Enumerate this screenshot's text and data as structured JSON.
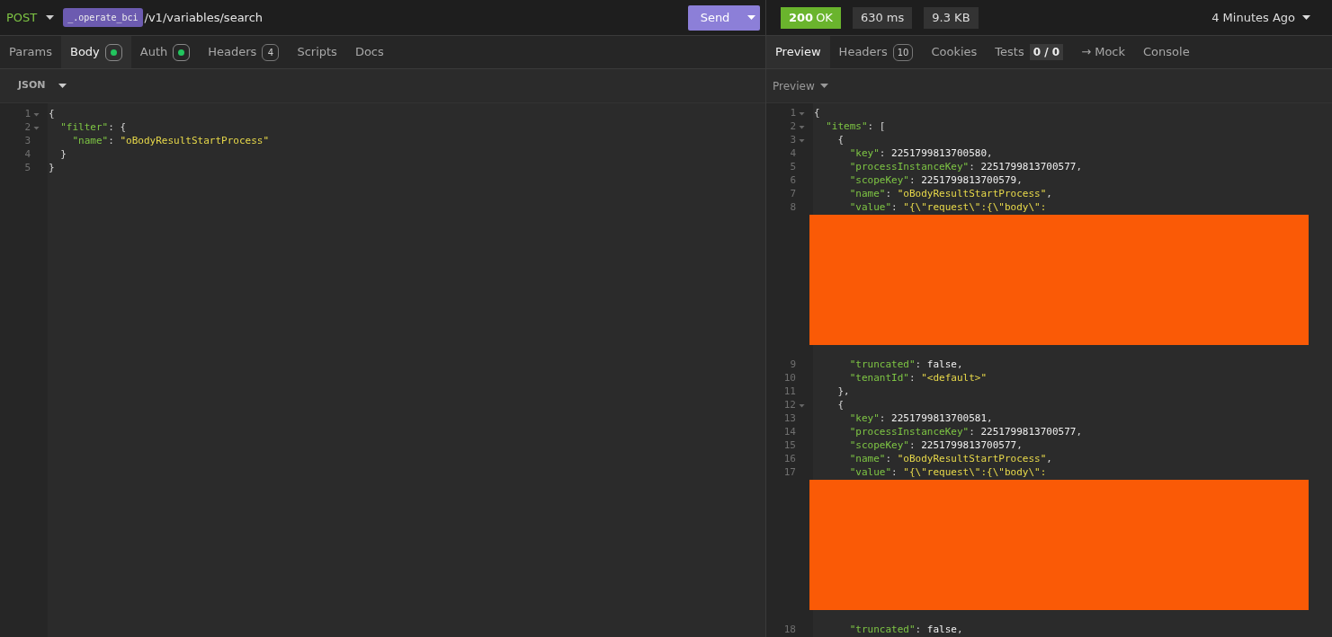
{
  "request": {
    "method": "POST",
    "env_tag": "_.operate_bci",
    "path": "/v1/variables/search",
    "send": "Send"
  },
  "request_tabs": [
    {
      "label": "Params",
      "selected": false
    },
    {
      "label": "Body",
      "selected": true,
      "badge": {
        "kind": "dot"
      }
    },
    {
      "label": "Auth",
      "selected": false,
      "badge": {
        "kind": "dot"
      }
    },
    {
      "label": "Headers",
      "selected": false,
      "badge": {
        "kind": "count",
        "text": "4"
      }
    },
    {
      "label": "Scripts",
      "selected": false
    },
    {
      "label": "Docs",
      "selected": false
    }
  ],
  "body_type": "JSON",
  "request_body": [
    {
      "number": "1",
      "fold": true,
      "tokens": [
        {
          "kind": "punct",
          "text": "{"
        }
      ]
    },
    {
      "number": "2",
      "fold": true,
      "tokens": [
        {
          "kind": "key",
          "text": "  \"filter\""
        },
        {
          "kind": "punct",
          "text": ": {"
        }
      ]
    },
    {
      "number": "3",
      "fold": false,
      "tokens": [
        {
          "kind": "key",
          "text": "    \"name\""
        },
        {
          "kind": "punct",
          "text": ": "
        },
        {
          "kind": "string",
          "text": "\"oBodyResultStartProcess\""
        }
      ]
    },
    {
      "number": "4",
      "fold": false,
      "tokens": [
        {
          "kind": "punct",
          "text": "  }"
        }
      ]
    },
    {
      "number": "5",
      "fold": false,
      "tokens": [
        {
          "kind": "punct",
          "text": "}"
        }
      ]
    }
  ],
  "response": {
    "status": "200",
    "status_text": "OK",
    "time": "630 ms",
    "size": "9.3 KB",
    "when": "4 Minutes Ago"
  },
  "response_tabs": [
    {
      "label": "Preview",
      "selected": true
    },
    {
      "label": "Headers",
      "selected": false,
      "badge": {
        "kind": "count",
        "text": "10"
      }
    },
    {
      "label": "Cookies",
      "selected": false
    },
    {
      "label": "Tests",
      "selected": false,
      "badge": {
        "kind": "score",
        "text": "0 / 0"
      }
    },
    {
      "label": "→ Mock",
      "selected": false
    },
    {
      "label": "Console",
      "selected": false
    }
  ],
  "preview_mode": "Preview",
  "response_body": [
    {
      "kind": "code",
      "number": "1",
      "fold": true,
      "tokens": [
        {
          "kind": "punct",
          "text": "{"
        }
      ]
    },
    {
      "kind": "code",
      "number": "2",
      "fold": true,
      "tokens": [
        {
          "kind": "key",
          "text": "  \"items\""
        },
        {
          "kind": "punct",
          "text": ": ["
        }
      ]
    },
    {
      "kind": "code",
      "number": "3",
      "fold": true,
      "tokens": [
        {
          "kind": "punct",
          "text": "    {"
        }
      ]
    },
    {
      "kind": "code",
      "number": "4",
      "fold": false,
      "tokens": [
        {
          "kind": "key",
          "text": "      \"key\""
        },
        {
          "kind": "punct",
          "text": ": "
        },
        {
          "kind": "number",
          "text": "2251799813700580"
        },
        {
          "kind": "punct",
          "text": ","
        }
      ]
    },
    {
      "kind": "code",
      "number": "5",
      "fold": false,
      "tokens": [
        {
          "kind": "key",
          "text": "      \"processInstanceKey\""
        },
        {
          "kind": "punct",
          "text": ": "
        },
        {
          "kind": "number",
          "text": "2251799813700577"
        },
        {
          "kind": "punct",
          "text": ","
        }
      ]
    },
    {
      "kind": "code",
      "number": "6",
      "fold": false,
      "tokens": [
        {
          "kind": "key",
          "text": "      \"scopeKey\""
        },
        {
          "kind": "punct",
          "text": ": "
        },
        {
          "kind": "number",
          "text": "2251799813700579"
        },
        {
          "kind": "punct",
          "text": ","
        }
      ]
    },
    {
      "kind": "code",
      "number": "7",
      "fold": false,
      "tokens": [
        {
          "kind": "key",
          "text": "      \"name\""
        },
        {
          "kind": "punct",
          "text": ": "
        },
        {
          "kind": "string",
          "text": "\"oBodyResultStartProcess\""
        },
        {
          "kind": "punct",
          "text": ","
        }
      ]
    },
    {
      "kind": "code",
      "number": "8",
      "fold": false,
      "tokens": [
        {
          "kind": "key",
          "text": "      \"value\""
        },
        {
          "kind": "punct",
          "text": ": "
        },
        {
          "kind": "string",
          "text": "\"{\\\"request\\\":{\\\"body\\\":"
        }
      ]
    },
    {
      "kind": "redacted"
    },
    {
      "kind": "code",
      "number": "9",
      "fold": false,
      "tokens": [
        {
          "kind": "key",
          "text": "      \"truncated\""
        },
        {
          "kind": "punct",
          "text": ": "
        },
        {
          "kind": "number",
          "text": "false"
        },
        {
          "kind": "punct",
          "text": ","
        }
      ]
    },
    {
      "kind": "code",
      "number": "10",
      "fold": false,
      "tokens": [
        {
          "kind": "key",
          "text": "      \"tenantId\""
        },
        {
          "kind": "punct",
          "text": ": "
        },
        {
          "kind": "string",
          "text": "\"<default>\""
        }
      ]
    },
    {
      "kind": "code",
      "number": "11",
      "fold": false,
      "tokens": [
        {
          "kind": "punct",
          "text": "    },"
        }
      ]
    },
    {
      "kind": "code",
      "number": "12",
      "fold": true,
      "tokens": [
        {
          "kind": "punct",
          "text": "    {"
        }
      ]
    },
    {
      "kind": "code",
      "number": "13",
      "fold": false,
      "tokens": [
        {
          "kind": "key",
          "text": "      \"key\""
        },
        {
          "kind": "punct",
          "text": ": "
        },
        {
          "kind": "number",
          "text": "2251799813700581"
        },
        {
          "kind": "punct",
          "text": ","
        }
      ]
    },
    {
      "kind": "code",
      "number": "14",
      "fold": false,
      "tokens": [
        {
          "kind": "key",
          "text": "      \"processInstanceKey\""
        },
        {
          "kind": "punct",
          "text": ": "
        },
        {
          "kind": "number",
          "text": "2251799813700577"
        },
        {
          "kind": "punct",
          "text": ","
        }
      ]
    },
    {
      "kind": "code",
      "number": "15",
      "fold": false,
      "tokens": [
        {
          "kind": "key",
          "text": "      \"scopeKey\""
        },
        {
          "kind": "punct",
          "text": ": "
        },
        {
          "kind": "number",
          "text": "2251799813700577"
        },
        {
          "kind": "punct",
          "text": ","
        }
      ]
    },
    {
      "kind": "code",
      "number": "16",
      "fold": false,
      "tokens": [
        {
          "kind": "key",
          "text": "      \"name\""
        },
        {
          "kind": "punct",
          "text": ": "
        },
        {
          "kind": "string",
          "text": "\"oBodyResultStartProcess\""
        },
        {
          "kind": "punct",
          "text": ","
        }
      ]
    },
    {
      "kind": "code",
      "number": "17",
      "fold": false,
      "tokens": [
        {
          "kind": "key",
          "text": "      \"value\""
        },
        {
          "kind": "punct",
          "text": ": "
        },
        {
          "kind": "string",
          "text": "\"{\\\"request\\\":{\\\"body\\\":"
        }
      ]
    },
    {
      "kind": "redacted"
    },
    {
      "kind": "code",
      "number": "18",
      "fold": false,
      "tokens": [
        {
          "kind": "key",
          "text": "      \"truncated\""
        },
        {
          "kind": "punct",
          "text": ": "
        },
        {
          "kind": "number",
          "text": "false"
        },
        {
          "kind": "punct",
          "text": ","
        }
      ]
    }
  ]
}
